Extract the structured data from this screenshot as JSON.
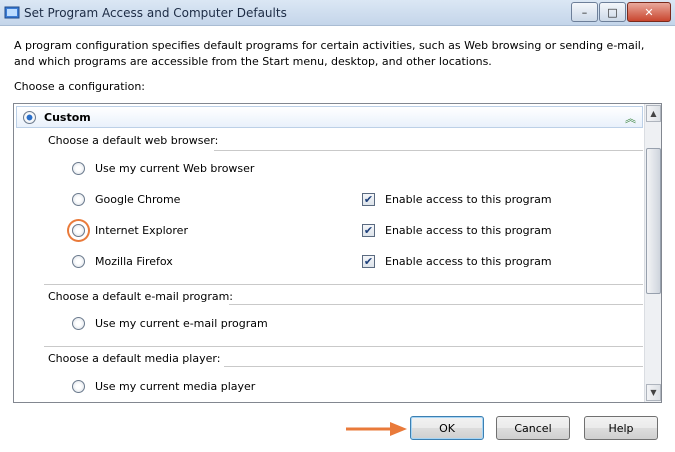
{
  "window": {
    "title": "Set Program Access and Computer Defaults",
    "controls": {
      "minimize": "–",
      "maximize": "□",
      "close": "✕"
    }
  },
  "description": "A program configuration specifies default programs for certain activities, such as Web browsing or sending e-mail, and which programs are accessible from the Start menu, desktop, and other locations.",
  "choose_label": "Choose a configuration:",
  "list": {
    "header": {
      "label": "Custom",
      "collapse_icon": "chevron-up-double"
    },
    "groups": [
      {
        "title": "Choose a default web browser:",
        "programs": [
          {
            "name": "Use my current Web browser",
            "selected": false,
            "checkbox": null
          },
          {
            "name": "Google Chrome",
            "selected": false,
            "checkbox": "Enable access to this program"
          },
          {
            "name": "Internet Explorer",
            "selected": false,
            "checkbox": "Enable access to this program"
          },
          {
            "name": "Mozilla Firefox",
            "selected": false,
            "checkbox": "Enable access to this program"
          }
        ]
      },
      {
        "title": "Choose a default e-mail program:",
        "programs": [
          {
            "name": "Use my current e-mail program",
            "selected": false,
            "checkbox": null
          }
        ]
      },
      {
        "title": "Choose a default media player:",
        "programs": [
          {
            "name": "Use my current media player",
            "selected": false,
            "checkbox": null
          }
        ]
      }
    ]
  },
  "buttons": {
    "ok": "OK",
    "cancel": "Cancel",
    "help": "Help"
  },
  "colors": {
    "accent": "#2a6fc9",
    "pointer": "#e97a3a"
  }
}
